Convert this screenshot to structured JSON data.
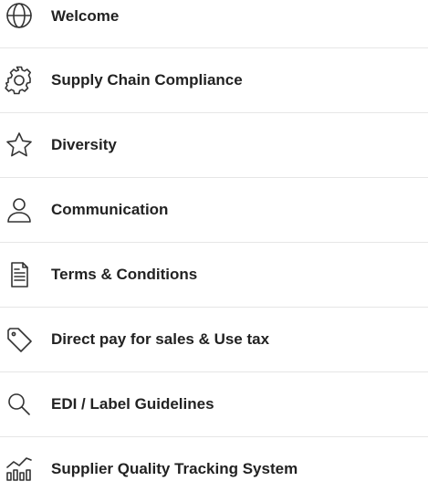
{
  "menu": {
    "items": [
      {
        "label": "Welcome",
        "icon": "globe-icon"
      },
      {
        "label": "Supply Chain Compliance",
        "icon": "gear-icon"
      },
      {
        "label": "Diversity",
        "icon": "star-icon"
      },
      {
        "label": "Communication",
        "icon": "user-icon"
      },
      {
        "label": "Terms & Conditions",
        "icon": "document-icon"
      },
      {
        "label": "Direct pay for sales & Use tax",
        "icon": "tag-icon"
      },
      {
        "label": "EDI / Label Guidelines",
        "icon": "search-icon"
      },
      {
        "label": "Supplier Quality Tracking System",
        "icon": "trend-chart-icon"
      }
    ]
  }
}
